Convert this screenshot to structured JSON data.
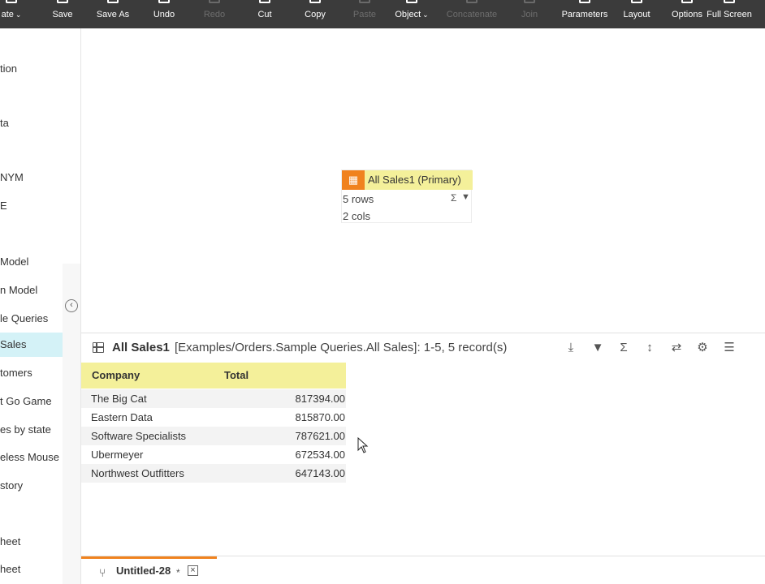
{
  "toolbar": {
    "items": [
      {
        "label": "ate",
        "caret": true,
        "disabled": false
      },
      {
        "label": "Save",
        "caret": false,
        "disabled": false
      },
      {
        "label": "Save As",
        "caret": false,
        "disabled": false
      },
      {
        "label": "Undo",
        "caret": false,
        "disabled": false
      },
      {
        "label": "Redo",
        "caret": false,
        "disabled": true
      },
      {
        "label": "Cut",
        "caret": false,
        "disabled": false
      },
      {
        "label": "Copy",
        "caret": false,
        "disabled": false
      },
      {
        "label": "Paste",
        "caret": false,
        "disabled": true
      },
      {
        "label": "Object",
        "caret": true,
        "disabled": false
      },
      {
        "label": "Concatenate",
        "caret": false,
        "disabled": true
      },
      {
        "label": "Join",
        "caret": false,
        "disabled": true
      },
      {
        "label": "Parameters",
        "caret": false,
        "disabled": false
      },
      {
        "label": "Layout",
        "caret": false,
        "disabled": false
      },
      {
        "label": "Options",
        "caret": false,
        "disabled": false
      },
      {
        "label": "Full Screen",
        "caret": false,
        "disabled": false
      }
    ]
  },
  "sidebar": {
    "items": [
      {
        "label": "tion",
        "active": false
      },
      {
        "label": "ta",
        "active": false
      },
      {
        "label": "NYM",
        "active": false
      },
      {
        "label": "E",
        "active": false
      },
      {
        "label": "Model",
        "active": false
      },
      {
        "label": "n Model",
        "active": false
      },
      {
        "label": "le Queries",
        "active": false
      },
      {
        "label": "Sales",
        "active": true
      },
      {
        "label": "tomers",
        "active": false
      },
      {
        "label": "t Go Game",
        "active": false
      },
      {
        "label": "es by state",
        "active": false
      },
      {
        "label": "eless Mouse",
        "active": false
      },
      {
        "label": "story",
        "active": false
      },
      {
        "label": "heet",
        "active": false
      },
      {
        "label": "heet",
        "active": false
      }
    ],
    "collapse_glyph": "‹"
  },
  "node": {
    "title": "All Sales1 (Primary)",
    "rows": "5 rows",
    "cols": "2 cols",
    "sigma": "Σ",
    "filter": "▼"
  },
  "result": {
    "name": "All Sales1",
    "path": "[Examples/Orders.Sample Queries.All Sales]: 1-5, 5 record(s)",
    "columns": [
      "Company",
      "Total"
    ],
    "rows": [
      {
        "company": "The Big Cat",
        "total": "817394.00"
      },
      {
        "company": "Eastern Data",
        "total": "815870.00"
      },
      {
        "company": "Software Specialists",
        "total": "787621.00"
      },
      {
        "company": "Ubermeyer",
        "total": "672534.00"
      },
      {
        "company": "Northwest Outfitters",
        "total": "647143.00"
      }
    ],
    "tools": [
      {
        "name": "download-icon",
        "glyph": "⤓"
      },
      {
        "name": "filter-icon",
        "glyph": "▼"
      },
      {
        "name": "sum-icon",
        "glyph": "Σ"
      },
      {
        "name": "sort-icon",
        "glyph": "↕"
      },
      {
        "name": "swap-icon",
        "glyph": "⇄"
      },
      {
        "name": "settings-icon",
        "glyph": "⚙"
      },
      {
        "name": "columns-icon",
        "glyph": "☰"
      }
    ]
  },
  "tabs": {
    "active_label": "Untitled-28",
    "modified_mark": "*",
    "close_glyph": "×",
    "icon_glyph": "⑂"
  },
  "colors": {
    "accent": "#f0821e",
    "highlight": "#f4f09a",
    "active_item": "#d4f2f7",
    "toolbar_bg": "#3b3b3b"
  }
}
